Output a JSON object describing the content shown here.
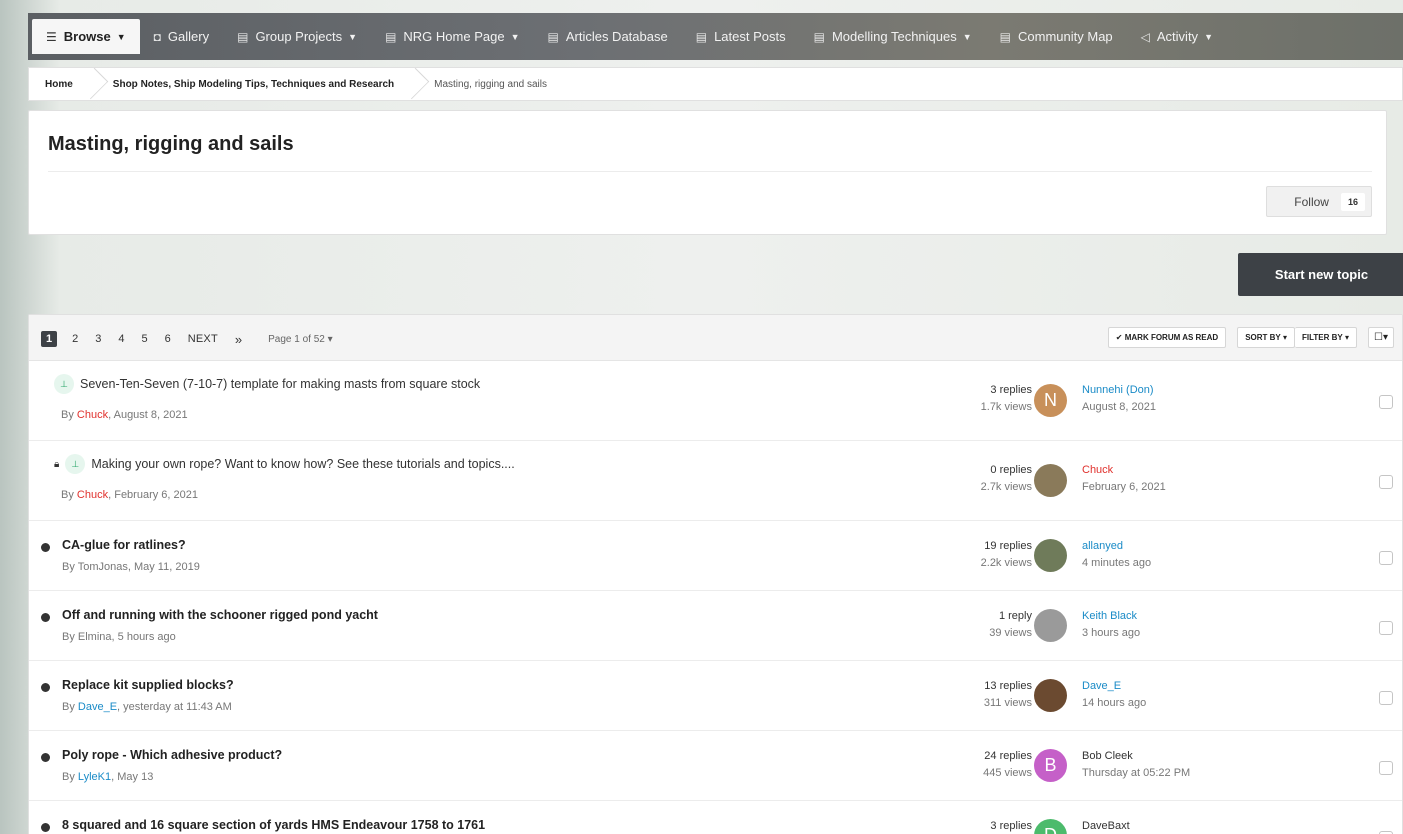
{
  "nav": {
    "items": [
      {
        "label": "Browse",
        "icon": "list-icon",
        "glyph": "☰",
        "caret": true,
        "active": true
      },
      {
        "label": "Gallery",
        "icon": "camera-icon",
        "glyph": "◘",
        "caret": false
      },
      {
        "label": "Group Projects",
        "icon": "document-icon",
        "glyph": "▤",
        "caret": true
      },
      {
        "label": "NRG Home Page",
        "icon": "document-icon",
        "glyph": "▤",
        "caret": true
      },
      {
        "label": "Articles Database",
        "icon": "document-icon",
        "glyph": "▤",
        "caret": false
      },
      {
        "label": "Latest Posts",
        "icon": "document-icon",
        "glyph": "▤",
        "caret": false
      },
      {
        "label": "Modelling Techniques",
        "icon": "document-icon",
        "glyph": "▤",
        "caret": true
      },
      {
        "label": "Community Map",
        "icon": "document-icon",
        "glyph": "▤",
        "caret": false
      },
      {
        "label": "Activity",
        "icon": "megaphone-icon",
        "glyph": "◁",
        "caret": true
      }
    ]
  },
  "breadcrumb": {
    "home": "Home",
    "parent": "Shop Notes, Ship Modeling Tips, Techniques and Research",
    "current": "Masting, rigging and sails"
  },
  "header": {
    "title": "Masting, rigging and sails",
    "follow_label": "Follow",
    "follow_count": "16"
  },
  "start_topic_label": "Start new topic",
  "pagination": {
    "pages": [
      "1",
      "2",
      "3",
      "4",
      "5",
      "6"
    ],
    "next": "NEXT",
    "jump": "»",
    "page_of": "Page 1 of 52"
  },
  "tools": {
    "mark_read": "✔ MARK FORUM AS READ",
    "sort_by": "SORT BY",
    "filter_by": "FILTER BY"
  },
  "topics": [
    {
      "title": "Seven-Ten-Seven (7-10-7) template for making masts from square stock",
      "pinned": true,
      "locked": false,
      "author": "Chuck",
      "author_color": "red",
      "date": "August 8, 2021",
      "replies": "3 replies",
      "views": "1.7k views",
      "last_user": "Nunnehi (Don)",
      "last_user_color": "blue",
      "last_date": "August 8, 2021",
      "avatar_letter": "N",
      "avatar_color": "#c8905a"
    },
    {
      "title": "Making your own rope? Want to know how? See these tutorials and topics....",
      "pinned": true,
      "locked": true,
      "author": "Chuck",
      "author_color": "red",
      "date": "February 6, 2021",
      "replies": "0 replies",
      "views": "2.7k views",
      "last_user": "Chuck",
      "last_user_color": "red",
      "last_date": "February 6, 2021",
      "avatar_letter": "",
      "avatar_color": "#8a7a5a"
    },
    {
      "title": "CA-glue for ratlines?",
      "pinned": false,
      "locked": false,
      "author": "TomJonas",
      "author_color": "gray",
      "date": "May 11, 2019",
      "replies": "19 replies",
      "views": "2.2k views",
      "last_user": "allanyed",
      "last_user_color": "blue",
      "last_date": "4 minutes ago",
      "avatar_letter": "",
      "avatar_color": "#6f7b5a"
    },
    {
      "title": "Off and running with the schooner rigged pond yacht",
      "pinned": false,
      "locked": false,
      "author": "Elmina",
      "author_color": "gray",
      "date": "5 hours ago",
      "replies": "1 reply",
      "views": "39 views",
      "last_user": "Keith Black",
      "last_user_color": "blue",
      "last_date": "3 hours ago",
      "avatar_letter": "",
      "avatar_color": "#9a9a9a"
    },
    {
      "title": "Replace kit supplied blocks?",
      "pinned": false,
      "locked": false,
      "author": "Dave_E",
      "author_color": "blue",
      "date": "yesterday at 11:43 AM",
      "replies": "13 replies",
      "views": "311 views",
      "last_user": "Dave_E",
      "last_user_color": "blue",
      "last_date": "14 hours ago",
      "avatar_letter": "",
      "avatar_color": "#6b4a30"
    },
    {
      "title": "Poly rope - Which adhesive product?",
      "pinned": false,
      "locked": false,
      "author": "LyleK1",
      "author_color": "blue",
      "date": "May 13",
      "replies": "24 replies",
      "views": "445 views",
      "last_user": "Bob Cleek",
      "last_user_color": "gray",
      "last_date": "Thursday at 05:22 PM",
      "avatar_letter": "B",
      "avatar_color": "#c560c8"
    },
    {
      "title": "8 squared and 16 square section of yards HMS Endeavour 1758 to 1761",
      "pinned": false,
      "locked": false,
      "author": "",
      "author_color": "gray",
      "date": "",
      "replies": "3 replies",
      "views": "",
      "last_user": "DaveBaxt",
      "last_user_color": "gray",
      "last_date": "",
      "avatar_letter": "D",
      "avatar_color": "#4cbb6c"
    }
  ]
}
